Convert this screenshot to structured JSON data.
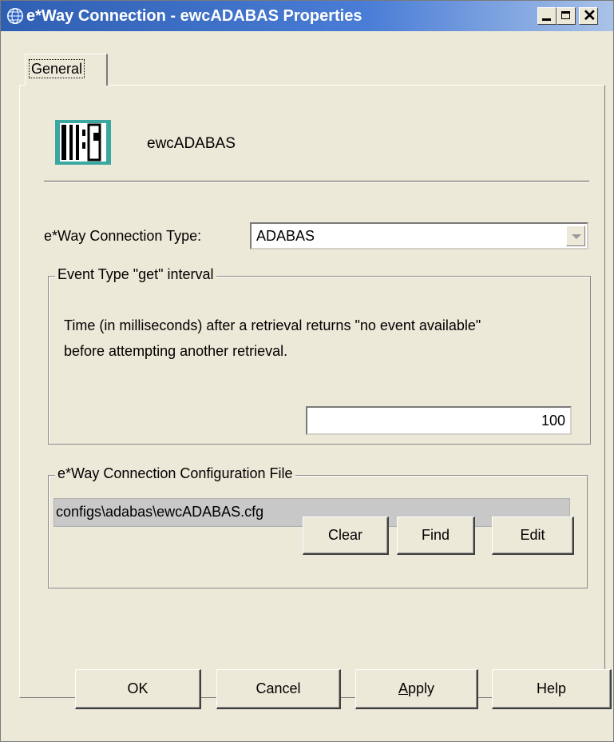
{
  "window": {
    "title": "e*Way Connection - ewcADABAS Properties",
    "icon": "globe-icon",
    "controls": {
      "minimize": "minimize-icon",
      "maximize": "maximize-icon",
      "close": "✕"
    }
  },
  "tabs": [
    {
      "label": "General",
      "selected": true
    }
  ],
  "general": {
    "connection_icon": "connection-module-icon",
    "connection_name": "ewcADABAS",
    "type_label": "e*Way Connection Type:",
    "type_value": "ADABAS",
    "interval_group": {
      "title": "Event Type \"get\" interval",
      "description": "Time (in milliseconds) after a retrieval returns \"no event available\" before attempting another retrieval.",
      "value": "100"
    },
    "config_group": {
      "title": "e*Way Connection Configuration File",
      "path": "configs\\adabas\\ewcADABAS.cfg",
      "buttons": {
        "clear": "Clear",
        "find": "Find",
        "edit": "Edit"
      }
    }
  },
  "footer": {
    "ok": "OK",
    "cancel": "Cancel",
    "apply_first": "A",
    "apply_rest": "pply",
    "help": "Help"
  },
  "colors": {
    "titlebar_start": "#2f5fb3",
    "titlebar_end": "#a9c2e8",
    "dialog_bg": "#ece9d8",
    "readonly_field": "#c8c8c8",
    "icon_teal": "#3aa7a0"
  }
}
